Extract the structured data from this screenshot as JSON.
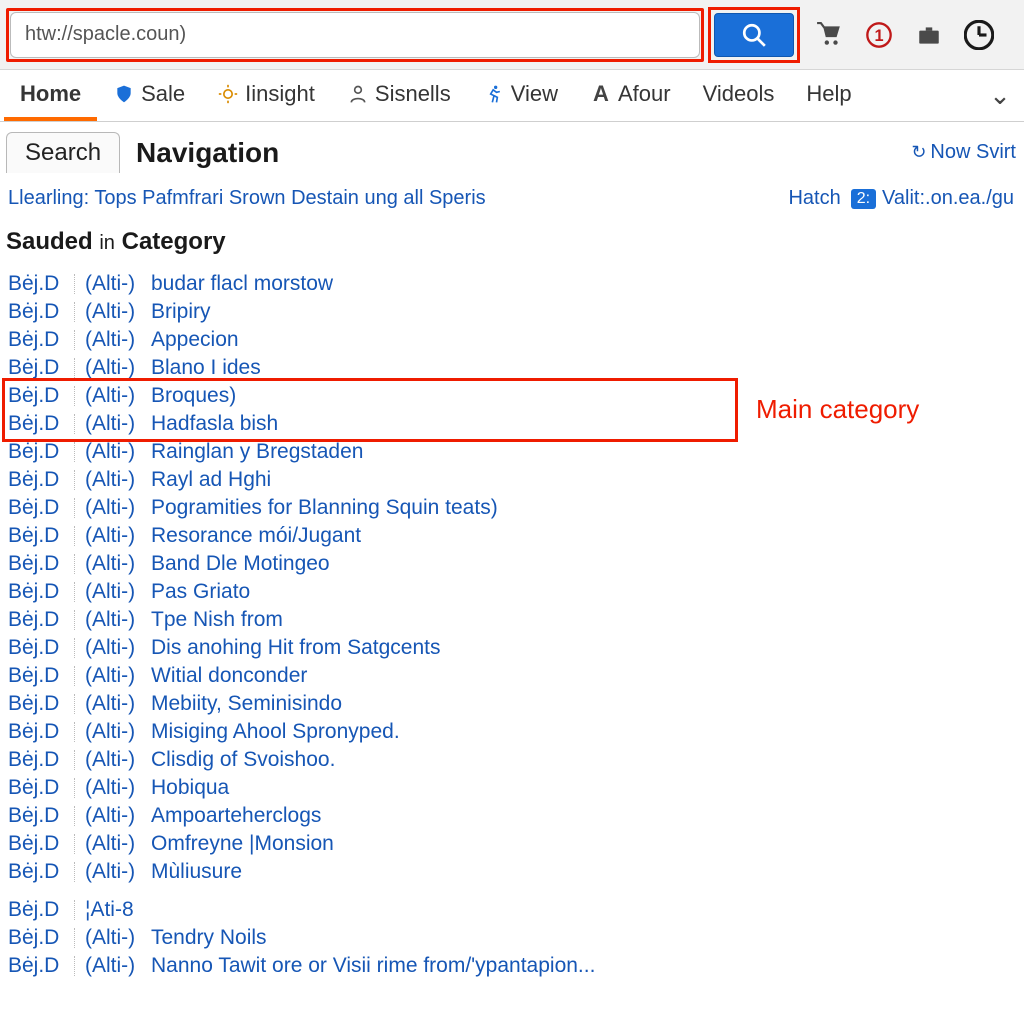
{
  "toolbar": {
    "url_value": "htw://spacle.coun)",
    "alert_badge": "①"
  },
  "nav": {
    "items": [
      {
        "label": "Home",
        "icon": ""
      },
      {
        "label": "Sale",
        "icon": "shield"
      },
      {
        "label": "Iinsight",
        "icon": "sun"
      },
      {
        "label": "Sisnells",
        "icon": "person"
      },
      {
        "label": "View",
        "icon": "run"
      },
      {
        "label": "Afour",
        "icon": "A"
      },
      {
        "label": "Videols",
        "icon": ""
      },
      {
        "label": "Help",
        "icon": ""
      }
    ]
  },
  "tabs": {
    "tab_label": "Search",
    "heading": "Navigation",
    "now_start": "Now Svirt"
  },
  "subline": {
    "text": "Llearling: Tops Pafmfrari Srown Destain ung all Speris",
    "hatch": "Hatch",
    "badge": "2:",
    "valit": "Valit:.on.ea./gu"
  },
  "section": {
    "prefix": "Sauded",
    "in": "in",
    "suffix": "Category"
  },
  "tags": {
    "a": "Bėj.D",
    "b": "(Alti-)",
    "b2": "¦Ati-8"
  },
  "categories": [
    "budar flacl morstow",
    "Bripiry",
    "Appecion",
    "Blano I ides",
    "Broques)",
    "Hadfasla bish",
    "Rainglan y Bregstaden",
    "Rayl ad Hghi",
    "Pogramities for Blanning Squin teats)",
    "Resorance mói/Jugant",
    "Band Dle Motingeo",
    "Pas Griato",
    "Tpe Nish from",
    "Dis anohing Hit from Satgcents",
    "Witial donconder",
    "Mebiity, Seminisindo",
    "Misiging Ahool Spronyped.",
    "Clisdig of Svoishoo.",
    "Hobiqua",
    "Ampoarteherclogs",
    "Omfreyne |Monsion",
    "Mùliusure"
  ],
  "categories_tail": [
    "",
    "Tendry Noils",
    "Nanno Tawit ore or Visii rime from/'ypantapion..."
  ],
  "annotation": {
    "label": "Main category"
  }
}
